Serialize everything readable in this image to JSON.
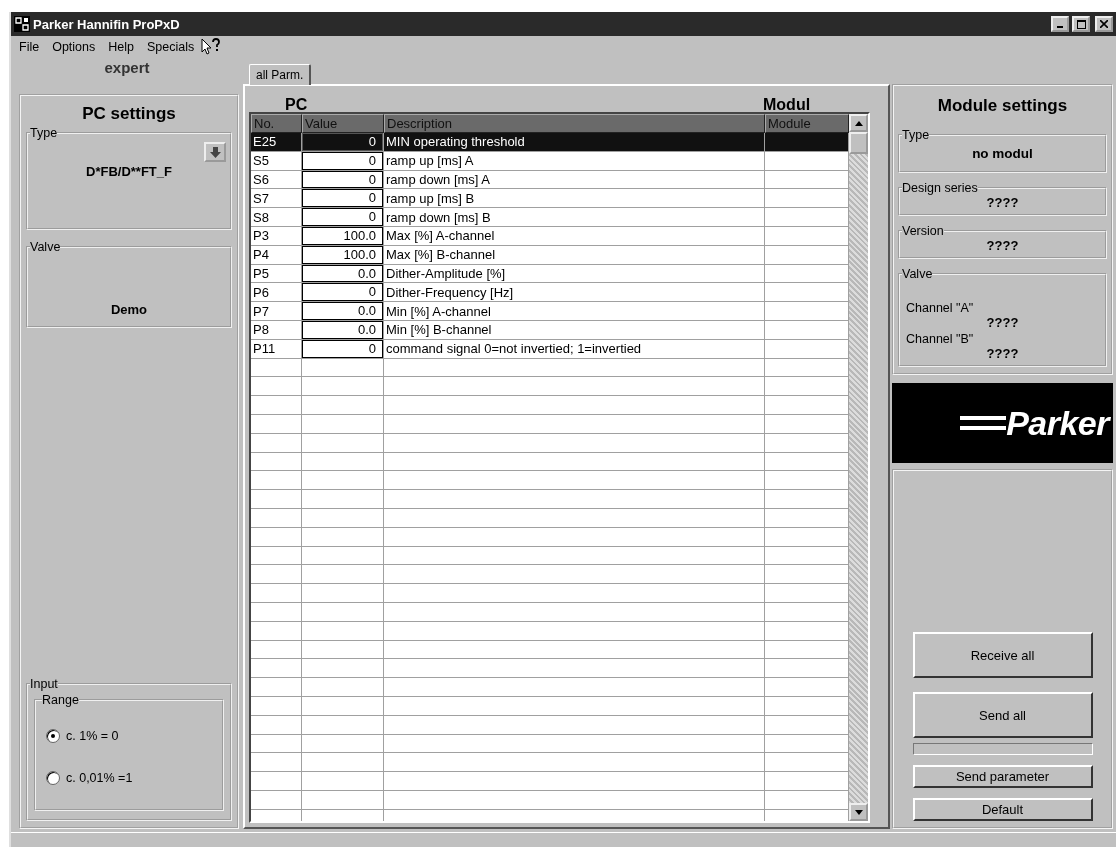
{
  "window": {
    "title": "Parker Hannifin ProPxD"
  },
  "menu": [
    {
      "label": "File"
    },
    {
      "label": "Options"
    },
    {
      "label": "Help"
    },
    {
      "label": "Specials"
    }
  ],
  "left": {
    "mode": "expert",
    "title": "PC settings",
    "type": {
      "label": "Type",
      "value": "D*FB/D**FT_F"
    },
    "valve": {
      "label": "Valve",
      "value": "Demo"
    },
    "input": {
      "label": "Input",
      "range": {
        "label": "Range",
        "options": [
          {
            "label": "c. 1% = 0",
            "selected": true
          },
          {
            "label": "c. 0,01% =1",
            "selected": false
          }
        ]
      }
    }
  },
  "tabs": [
    {
      "label": "all Parm.",
      "selected": true
    }
  ],
  "table": {
    "group_pc": "PC",
    "group_modul": "Modul",
    "columns": [
      "No.",
      "Value",
      "Description",
      "Module"
    ],
    "rows": [
      {
        "no": "E25",
        "value": "0",
        "description": "MIN operating threshold",
        "selected": true
      },
      {
        "no": "S5",
        "value": "0",
        "description": "ramp up [ms] A",
        "selected": false
      },
      {
        "no": "S6",
        "value": "0",
        "description": "ramp down [ms] A",
        "selected": false
      },
      {
        "no": "S7",
        "value": "0",
        "description": "ramp up [ms] B",
        "selected": false
      },
      {
        "no": "S8",
        "value": "0",
        "description": "ramp down [ms] B",
        "selected": false
      },
      {
        "no": "P3",
        "value": "100.0",
        "description": "Max [%] A-channel",
        "selected": false
      },
      {
        "no": "P4",
        "value": "100.0",
        "description": "Max [%] B-channel",
        "selected": false
      },
      {
        "no": "P5",
        "value": "0.0",
        "description": "Dither-Amplitude [%]",
        "selected": false
      },
      {
        "no": "P6",
        "value": "0",
        "description": "Dither-Frequency [Hz]",
        "selected": false
      },
      {
        "no": "P7",
        "value": "0.0",
        "description": "Min [%] A-channel",
        "selected": false
      },
      {
        "no": "P8",
        "value": "0.0",
        "description": "Min [%] B-channel",
        "selected": false
      },
      {
        "no": "P11",
        "value": "0",
        "description": "command signal 0=not invertied; 1=invertied",
        "selected": false
      }
    ]
  },
  "right": {
    "title": "Module settings",
    "type": {
      "label": "Type",
      "value": "no modul"
    },
    "design_series": {
      "label": "Design series",
      "value": "????"
    },
    "version": {
      "label": "Version",
      "value": "????"
    },
    "valve": {
      "label": "Valve",
      "channels": [
        {
          "label": "Channel \"A\"",
          "value": "????"
        },
        {
          "label": "Channel \"B\"",
          "value": "????"
        }
      ]
    },
    "logo": "Parker",
    "buttons_large": [
      "Receive all",
      "Send all"
    ],
    "buttons_small": [
      "Send parameter",
      "Default"
    ]
  }
}
